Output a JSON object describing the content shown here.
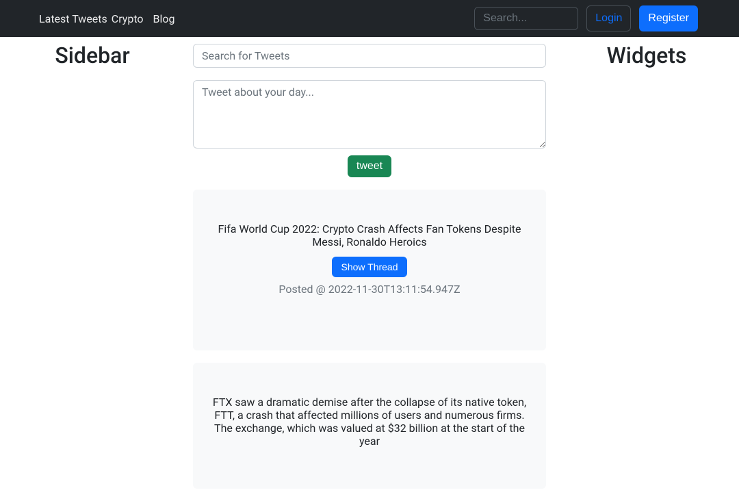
{
  "nav": {
    "links": [
      "Latest Tweets",
      "Crypto",
      "Blog"
    ],
    "search_placeholder": "Search...",
    "login": "Login",
    "register": "Register"
  },
  "sidebar": {
    "title": "Sidebar"
  },
  "widgets": {
    "title": "Widgets"
  },
  "main": {
    "search_placeholder": "Search for Tweets",
    "compose_placeholder": "Tweet about your day...",
    "tweet_button": "tweet"
  },
  "tweets": [
    {
      "title": "Fifa World Cup 2022: Crypto Crash Affects Fan Tokens Despite Messi, Ronaldo Heroics",
      "show_thread": "Show Thread",
      "posted": "Posted @ 2022-11-30T13:11:54.947Z"
    },
    {
      "title": "FTX saw a dramatic demise after the collapse of its native token, FTT, a crash that affected millions of users and numerous firms. The exchange, which was valued at $32 billion at the start of the year"
    }
  ]
}
